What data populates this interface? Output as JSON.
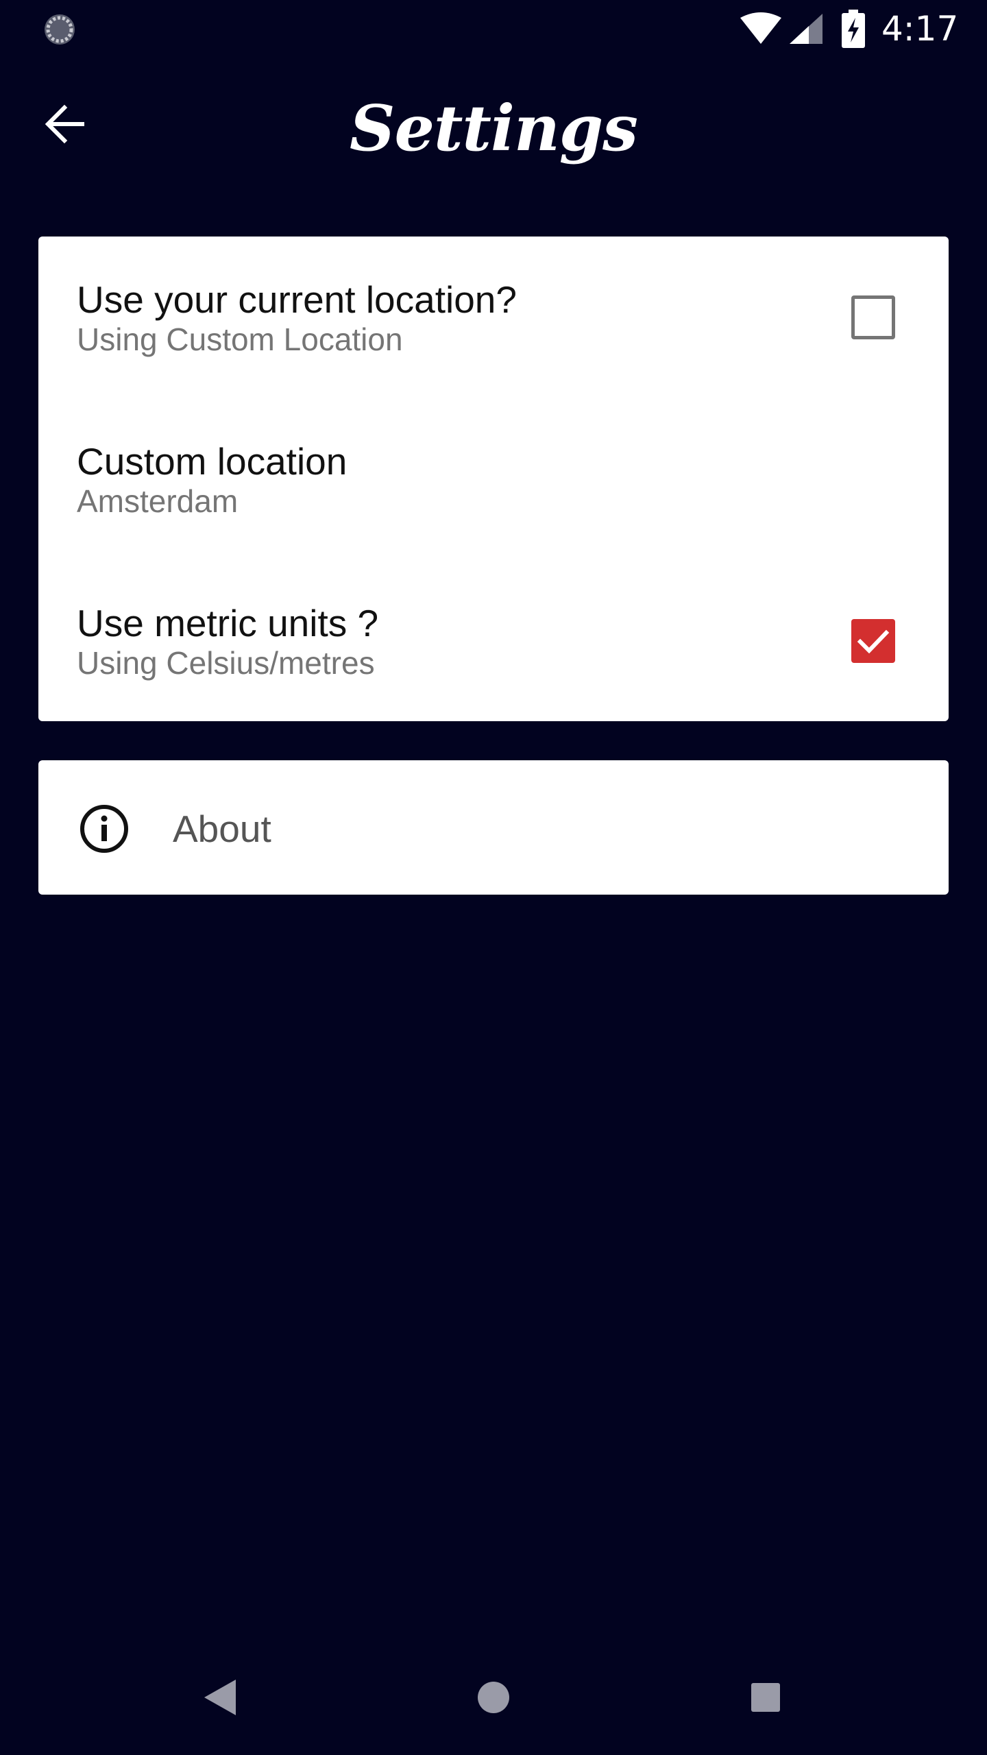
{
  "status_bar": {
    "time": "4:17",
    "icons": [
      "loading-icon",
      "wifi-icon",
      "cell-signal-icon",
      "battery-charging-icon"
    ]
  },
  "app_bar": {
    "title": "Settings",
    "back_icon": "arrow-back-icon"
  },
  "preferences": [
    {
      "title": "Use your current location?",
      "summary": "Using Custom Location",
      "control": "checkbox",
      "checked": false
    },
    {
      "title": "Custom location",
      "summary": "Amsterdam"
    },
    {
      "title": "Use metric units ?",
      "summary": "Using Celsius/metres",
      "control": "checkbox",
      "checked": true
    }
  ],
  "about": {
    "label": "About",
    "icon": "info-icon"
  },
  "nav_bar": {
    "icons": [
      "nav-back-icon",
      "nav-home-icon",
      "nav-recents-icon"
    ]
  },
  "colors": {
    "background": "#020320",
    "card": "#ffffff",
    "accent": "#d32f2f",
    "title_text": "#111111",
    "summary_text": "#757575"
  }
}
